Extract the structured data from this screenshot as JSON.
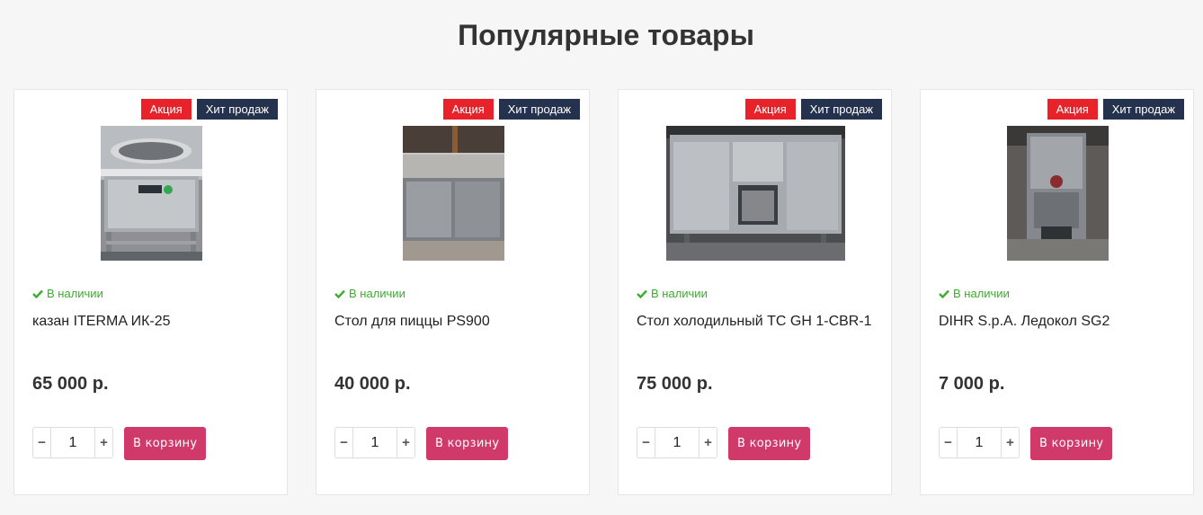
{
  "section_title": "Популярные товары",
  "colors": {
    "sale_badge": "#e8222a",
    "hit_badge": "#24324d",
    "in_stock": "#3aad2c",
    "cart_button": "#cf3a6b"
  },
  "products": [
    {
      "badge_sale": "Акция",
      "badge_hit": "Хит продаж",
      "stock": "В наличии",
      "title": "казан ITERMA ИК-25",
      "price": "65 000 р.",
      "qty": "1",
      "minus": "−",
      "plus": "+",
      "cart": "В корзину"
    },
    {
      "badge_sale": "Акция",
      "badge_hit": "Хит продаж",
      "stock": "В наличии",
      "title": "Стол для пиццы PS900",
      "price": "40 000 р.",
      "qty": "1",
      "minus": "−",
      "plus": "+",
      "cart": "В корзину"
    },
    {
      "badge_sale": "Акция",
      "badge_hit": "Хит продаж",
      "stock": "В наличии",
      "title": "Стол холодильный TC GH 1-CBR-1",
      "price": "75 000 р.",
      "qty": "1",
      "minus": "−",
      "plus": "+",
      "cart": "В корзину"
    },
    {
      "badge_sale": "Акция",
      "badge_hit": "Хит продаж",
      "stock": "В наличии",
      "title": "DIHR S.p.A. Ледокол SG2",
      "price": "7 000 р.",
      "qty": "1",
      "minus": "−",
      "plus": "+",
      "cart": "В корзину"
    }
  ]
}
